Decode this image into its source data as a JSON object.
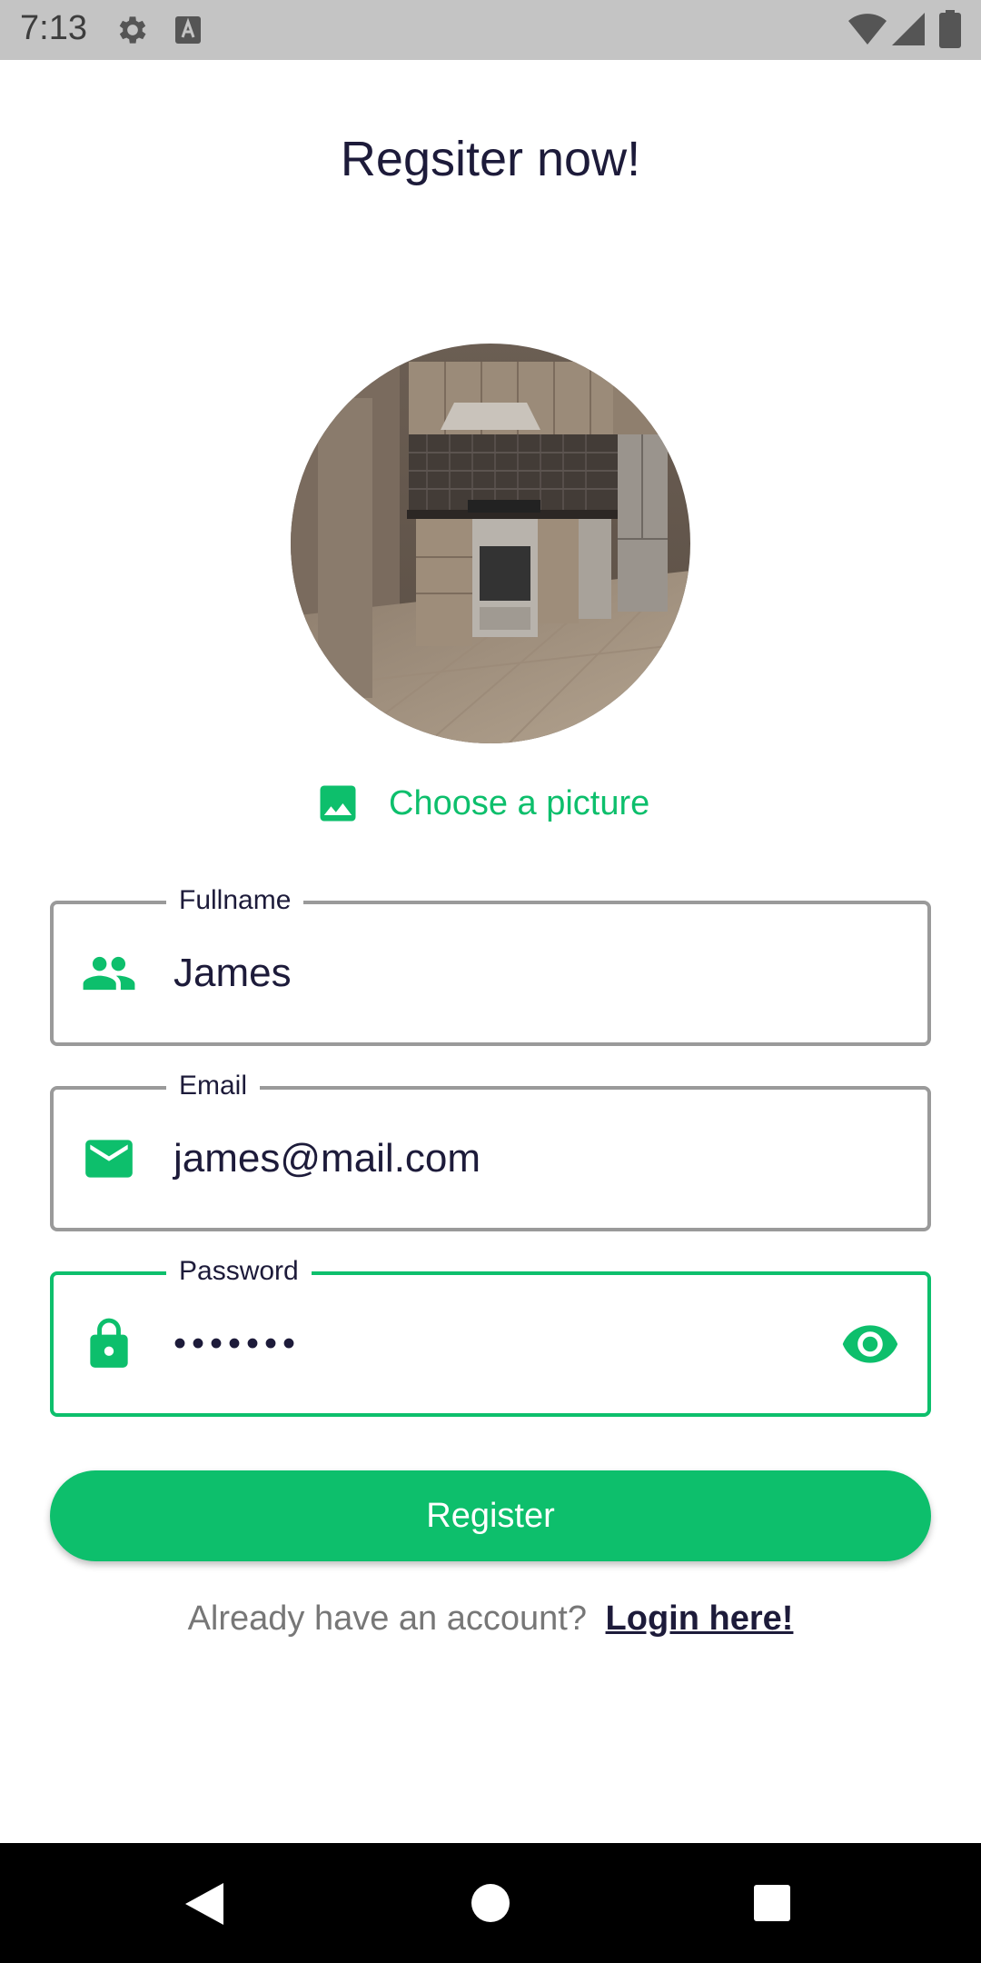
{
  "status_bar": {
    "time": "7:13",
    "icons": [
      "gear-icon",
      "keyboard-a-icon",
      "wifi-icon",
      "signal-icon",
      "battery-icon"
    ]
  },
  "page": {
    "title": "Regsiter now!"
  },
  "avatar": {
    "description_icon": "profile-photo"
  },
  "choose_picture": {
    "label": "Choose a picture",
    "icon": "image-icon"
  },
  "form": {
    "fullname": {
      "label": "Fullname",
      "value": "James",
      "icon": "people-icon"
    },
    "email": {
      "label": "Email",
      "value": "james@mail.com",
      "icon": "mail-icon"
    },
    "password": {
      "label": "Password",
      "value": "•••••••",
      "icon": "lock-icon",
      "toggle_icon": "eye-icon"
    }
  },
  "register_button": {
    "label": "Register"
  },
  "login": {
    "prompt": "Already have an account?",
    "link": "Login here!"
  },
  "nav_bar": {
    "icons": [
      "back-icon",
      "home-icon",
      "recents-icon"
    ]
  },
  "colors": {
    "accent": "#0dbf6c",
    "title_text": "#1d1b3a",
    "status_bar": "#c4c4c4",
    "field_border": "#9a9a9a"
  }
}
